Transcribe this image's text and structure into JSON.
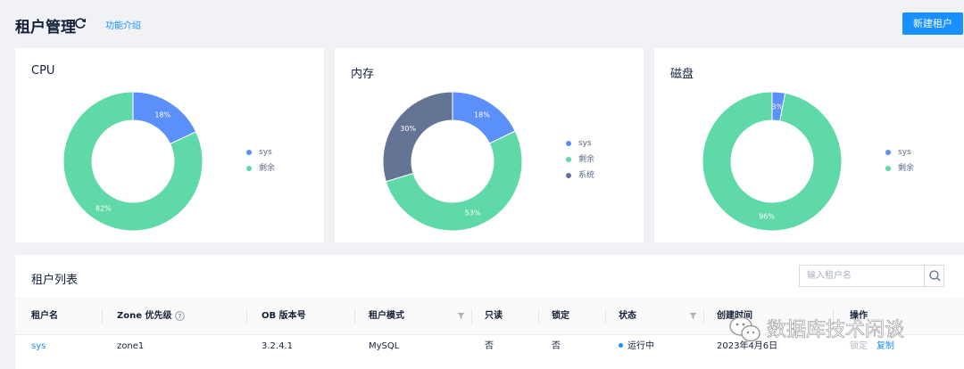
{
  "header": {
    "title": "租户管理",
    "intro_link": "功能介绍",
    "new_button": "新建租户"
  },
  "colors": {
    "sys": "#5b8ff9",
    "remaining": "#5fd9a7",
    "system": "#637495",
    "primary": "#1890ff",
    "running": "#1890ff"
  },
  "charts": {
    "cpu": {
      "title": "CPU",
      "legend": [
        "sys",
        "剩余"
      ],
      "labels": {
        "sys": "18%",
        "remaining": "82%"
      }
    },
    "memory": {
      "title": "内存",
      "legend": [
        "sys",
        "剩余",
        "系统"
      ],
      "labels": {
        "sys": "18%",
        "remaining": "53%",
        "system": "30%"
      }
    },
    "disk": {
      "title": "磁盘",
      "legend": [
        "sys",
        "剩余"
      ],
      "labels": {
        "sys": "3%",
        "remaining": "96%"
      }
    }
  },
  "chart_data": [
    {
      "type": "pie",
      "title": "CPU",
      "categories": [
        "sys",
        "剩余"
      ],
      "values": [
        18,
        82
      ]
    },
    {
      "type": "pie",
      "title": "内存",
      "categories": [
        "sys",
        "剩余",
        "系统"
      ],
      "values": [
        18,
        53,
        30
      ]
    },
    {
      "type": "pie",
      "title": "磁盘",
      "categories": [
        "sys",
        "剩余"
      ],
      "values": [
        3,
        96
      ]
    }
  ],
  "list": {
    "title": "租户列表",
    "search_placeholder": "输入租户名",
    "columns": {
      "name": "租户名",
      "zone": "Zone 优先级",
      "version": "OB 版本号",
      "mode": "租户模式",
      "readonly": "只读",
      "locked": "锁定",
      "status": "状态",
      "created": "创建时间",
      "actions": "操作"
    },
    "rows": [
      {
        "name": "sys",
        "zone": "zone1",
        "version": "3.2.4.1",
        "mode": "MySQL",
        "readonly": "否",
        "locked": "否",
        "status": "运行中",
        "created": "2023年4月6日",
        "action_lock": "锁定",
        "action_copy": "复制"
      }
    ]
  },
  "watermark": {
    "icon": "wechat-icon",
    "text": "数据库技术闲谈"
  }
}
